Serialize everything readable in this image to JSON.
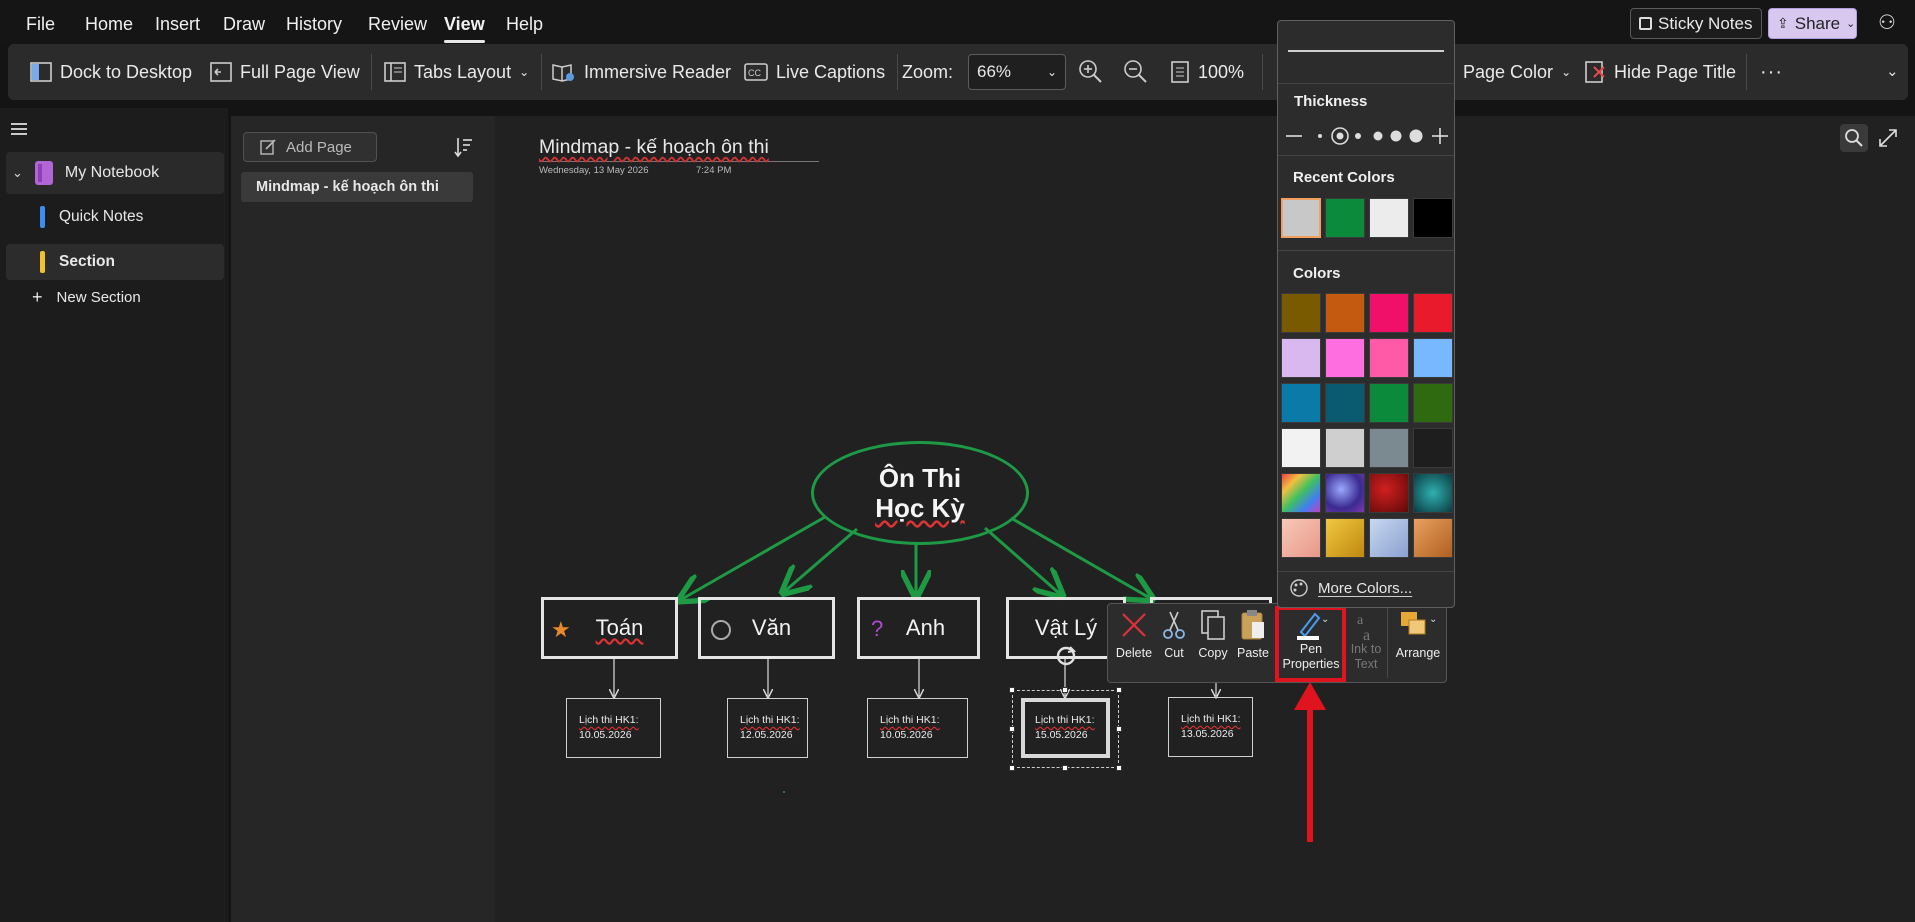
{
  "menubar": {
    "items": [
      "File",
      "Home",
      "Insert",
      "Draw",
      "History",
      "Review",
      "View",
      "Help"
    ],
    "active": "View",
    "sticky_notes": "Sticky Notes",
    "share": "Share"
  },
  "ribbon": {
    "dock": "Dock to Desktop",
    "full_page": "Full Page View",
    "tabs_layout": "Tabs Layout",
    "immersive": "Immersive Reader",
    "captions": "Live Captions",
    "zoom_label": "Zoom:",
    "zoom_value": "66%",
    "zoom_100": "100%",
    "page_color": "Page Color",
    "hide_title": "Hide Page Title",
    "more": "···"
  },
  "nav": {
    "notebook": "My Notebook",
    "sections": [
      {
        "label": "Quick Notes",
        "color": "#3b8ef0"
      },
      {
        "label": "Section",
        "color": "#f2c12e"
      }
    ],
    "new_section": "New Section"
  },
  "pagelist": {
    "add_page": "Add Page",
    "pages": [
      "Mindmap - kế hoạch ôn thi"
    ]
  },
  "page": {
    "title": "Mindmap - kế hoạch ôn thi",
    "date": "Wednesday, 13 May 2026",
    "time": "7:24 PM"
  },
  "mindmap": {
    "root_line1": "Ôn Thi",
    "root_line2": "Học Kỳ",
    "subjects": [
      {
        "label": "Toán",
        "icon": "star-icon",
        "glyph": "★",
        "color": "#e8892b"
      },
      {
        "label": "Văn",
        "icon": "circle-icon",
        "glyph": "◯",
        "color": "#bbbbbb"
      },
      {
        "label": "Anh",
        "icon": "question-icon",
        "glyph": "?",
        "color": "#b04bd0"
      },
      {
        "label": "Vật Lý",
        "icon": "",
        "glyph": "",
        "color": ""
      }
    ],
    "leaves": [
      {
        "line1": "Lịch thi HK1:",
        "line2": "10.05.2026"
      },
      {
        "line1": "Lịch thi HK1:",
        "line2": "12.05.2026"
      },
      {
        "line1": "Lịch thi HK1:",
        "line2": "10.05.2026"
      },
      {
        "line1": "Lịch thi HK1:",
        "line2": "15.05.2026"
      },
      {
        "line1": "Lịch thi HK1:",
        "line2": "13.05.2026"
      }
    ],
    "arrow_color": "#1e9a45"
  },
  "context_toolbar": {
    "delete": "Delete",
    "cut": "Cut",
    "copy": "Copy",
    "paste": "Paste",
    "pen_properties_1": "Pen",
    "pen_properties_2": "Properties",
    "ink_to_text_1": "Ink to",
    "ink_to_text_2": "Text",
    "arrange": "Arrange"
  },
  "color_popup": {
    "thickness": "Thickness",
    "recent_colors": "Recent Colors",
    "recent": [
      "#c8c8c8",
      "#0c8a3c",
      "#ececec",
      "#000000"
    ],
    "colors_heading": "Colors",
    "colors": [
      [
        "#7a5a00",
        "#c35a10",
        "#f0106a",
        "#e81a2c"
      ],
      [
        "#d8b8ee",
        "#ff6ee0",
        "#ff5aa8",
        "#78b8ff"
      ],
      [
        "#0a7aa8",
        "#0a5a70",
        "#0a8a3a",
        "#2f6a10"
      ],
      [
        "#f2f2f2",
        "#cfcfcf",
        "#7a8a90",
        "#1e1e1e"
      ]
    ],
    "textures": [
      "#e05a5a",
      "#4a5ad0",
      "#b01010",
      "#0a7a7a",
      "#f0b8a8",
      "#e8b030",
      "#a8b8e0",
      "#d08a40"
    ],
    "more_colors": "More Colors..."
  },
  "highlight_color": "#e0141e"
}
